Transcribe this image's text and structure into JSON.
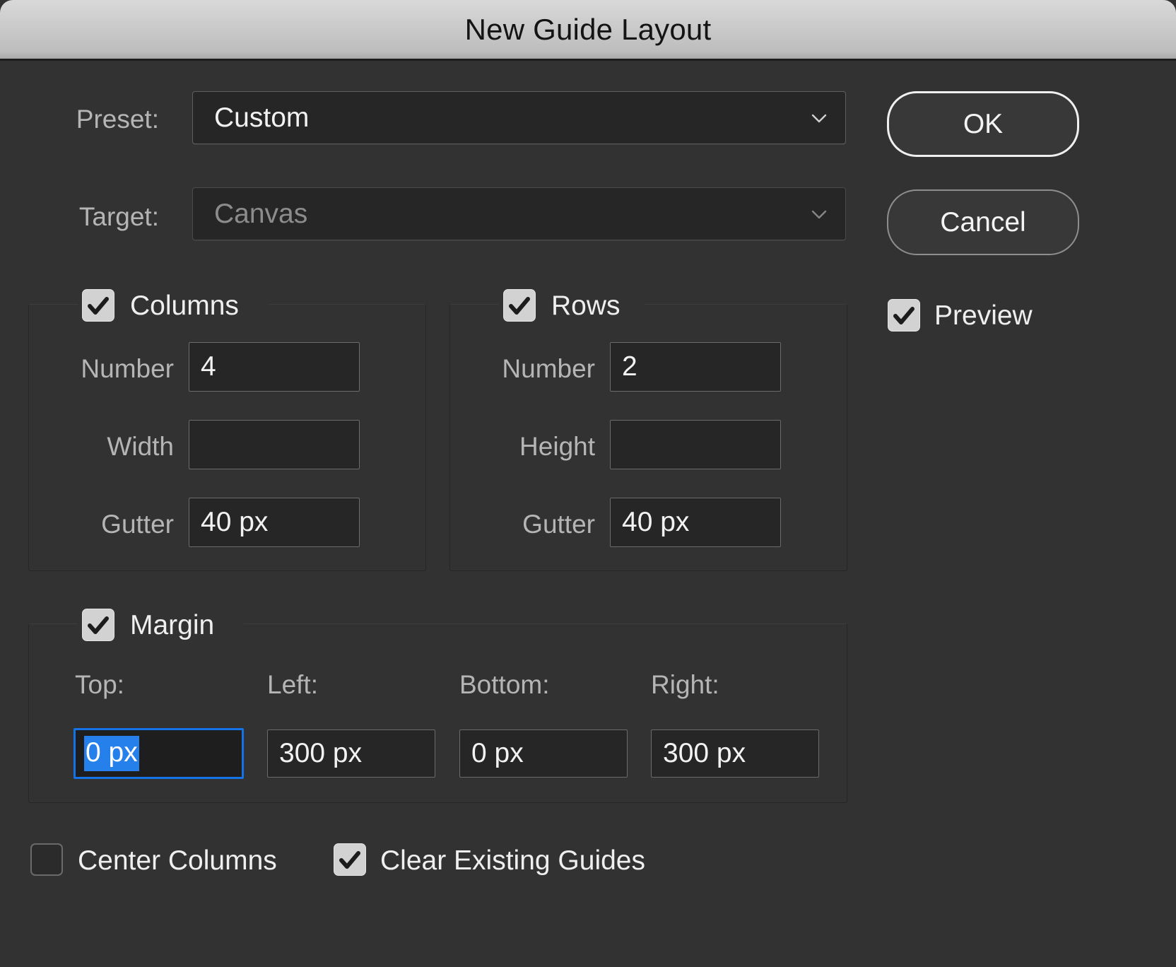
{
  "window": {
    "title": "New Guide Layout"
  },
  "preset": {
    "label": "Preset:",
    "value": "Custom",
    "chevron_icon": "chevron-down-icon"
  },
  "target": {
    "label": "Target:",
    "value": "Canvas",
    "chevron_icon": "chevron-down-icon",
    "disabled": true
  },
  "buttons": {
    "ok": "OK",
    "cancel": "Cancel"
  },
  "preview": {
    "label": "Preview",
    "checked": true
  },
  "columns": {
    "legend": "Columns",
    "checked": true,
    "fields": [
      {
        "label": "Number",
        "value": "4"
      },
      {
        "label": "Width",
        "value": ""
      },
      {
        "label": "Gutter",
        "value": "40 px"
      }
    ]
  },
  "rows": {
    "legend": "Rows",
    "checked": true,
    "fields": [
      {
        "label": "Number",
        "value": "2"
      },
      {
        "label": "Height",
        "value": ""
      },
      {
        "label": "Gutter",
        "value": "40 px"
      }
    ]
  },
  "margin": {
    "legend": "Margin",
    "checked": true,
    "fields": [
      {
        "label": "Top:",
        "value": "0 px",
        "focused": true
      },
      {
        "label": "Left:",
        "value": "300 px",
        "focused": false
      },
      {
        "label": "Bottom:",
        "value": "0 px",
        "focused": false
      },
      {
        "label": "Right:",
        "value": "300 px",
        "focused": false
      }
    ]
  },
  "options": {
    "center_columns": {
      "label": "Center Columns",
      "checked": false
    },
    "clear_existing_guides": {
      "label": "Clear Existing Guides",
      "checked": true
    }
  },
  "colors": {
    "dialog_background": "#323232",
    "titlebar_top": "#d9d9d9",
    "titlebar_bottom": "#a8a8a8",
    "input_background": "#262626",
    "input_border": "#6b6b6b",
    "focus_blue": "#1473e6",
    "selection_blue": "#2680eb",
    "label_text": "#b5b5b5",
    "value_text": "#f2f2f2",
    "checkbox_on": "#d2d2d2"
  }
}
